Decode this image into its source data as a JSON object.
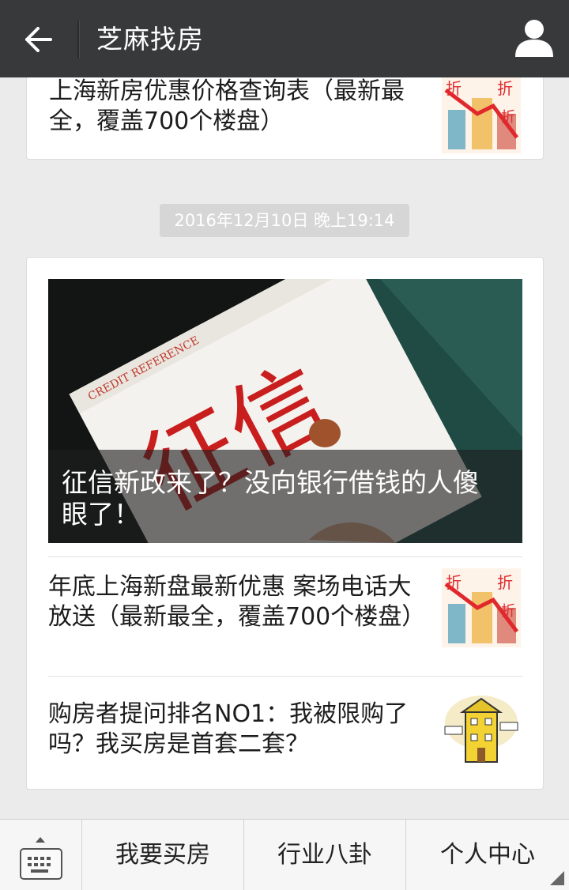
{
  "header": {
    "title": "芝麻找房"
  },
  "feed": {
    "prev_card": {
      "title": "上海新房优惠价格查询表（最新最全，覆盖700个楼盘）"
    },
    "timestamp": "2016年12月10日 晚上19:14",
    "main_card": {
      "hero_title": "征信新政来了？没向银行借钱的人傻眼了！",
      "items": [
        {
          "title": "年底上海新盘最新优惠 案场电话大放送（最新最全，覆盖700个楼盘）"
        },
        {
          "title": "购房者提问排名NO1：我被限购了吗？我买房是首套二套？"
        }
      ]
    }
  },
  "bottom_bar": {
    "menus": [
      "我要买房",
      "行业八卦",
      "个人中心"
    ]
  },
  "colors": {
    "header_bg": "#37393b",
    "page_bg": "#ebebeb",
    "timestamp_bg": "#d6d6d6"
  }
}
